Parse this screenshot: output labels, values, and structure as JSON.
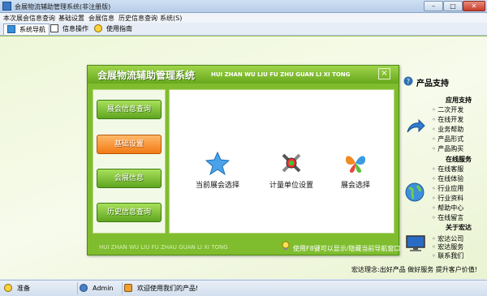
{
  "window": {
    "title": "会展物流辅助管理系统(非注册版)"
  },
  "menu": [
    "本次展会信息查询",
    "基础设置",
    "会展信息",
    "历史信息查询",
    "系统(S)"
  ],
  "tabs": [
    {
      "label": "系统导航",
      "active": true
    },
    {
      "label": "信息操作",
      "active": false
    },
    {
      "label": "使用指南",
      "active": false
    }
  ],
  "dialog": {
    "title": "会展物流辅助管理系统",
    "pinyin": "HUI ZHAN WU LIU FU ZHU GUAN LI XI TONG",
    "close": "×",
    "nav": [
      {
        "label": "展会信息查询",
        "active": false
      },
      {
        "label": "基础设置",
        "active": true
      },
      {
        "label": "会展信息",
        "active": false
      },
      {
        "label": "历史信息查询",
        "active": false
      }
    ],
    "actions": [
      {
        "label": "当前展会选择",
        "icon": "star-icon"
      },
      {
        "label": "计量单位设置",
        "icon": "tools-icon"
      },
      {
        "label": "展会选择",
        "icon": "butterfly-icon"
      }
    ],
    "footer_pinyin": "HUI ZHAN WU LIU FU ZHAU GUAN LI XI TONG",
    "footer_hint": "使用F8键可以显示/隐藏当前导航窗口"
  },
  "side": {
    "title": "产品支持",
    "groups": [
      {
        "heading": "应用支持",
        "links": [
          "二次开发",
          "在线开发",
          "业务帮助",
          "产品形式",
          "产品购买"
        ]
      },
      {
        "heading": "在线服务",
        "links": [
          "在线客服",
          "在线体验",
          "行业应用",
          "行业资料",
          "帮助中心",
          "在线留言"
        ]
      },
      {
        "heading": "关于宏达",
        "links": [
          "宏达公司",
          "宏达服务",
          "联系我们"
        ]
      }
    ]
  },
  "footer_text": "宏达理念:出好产品  做好服务  提升客户价值!",
  "status": [
    "准备",
    "Admin",
    "欢迎使用我们的产品!"
  ],
  "colors": {
    "dialog_green": "#7fbd2e",
    "active_orange": "#f27a15",
    "desktop_bg": "#f2f8e3"
  }
}
